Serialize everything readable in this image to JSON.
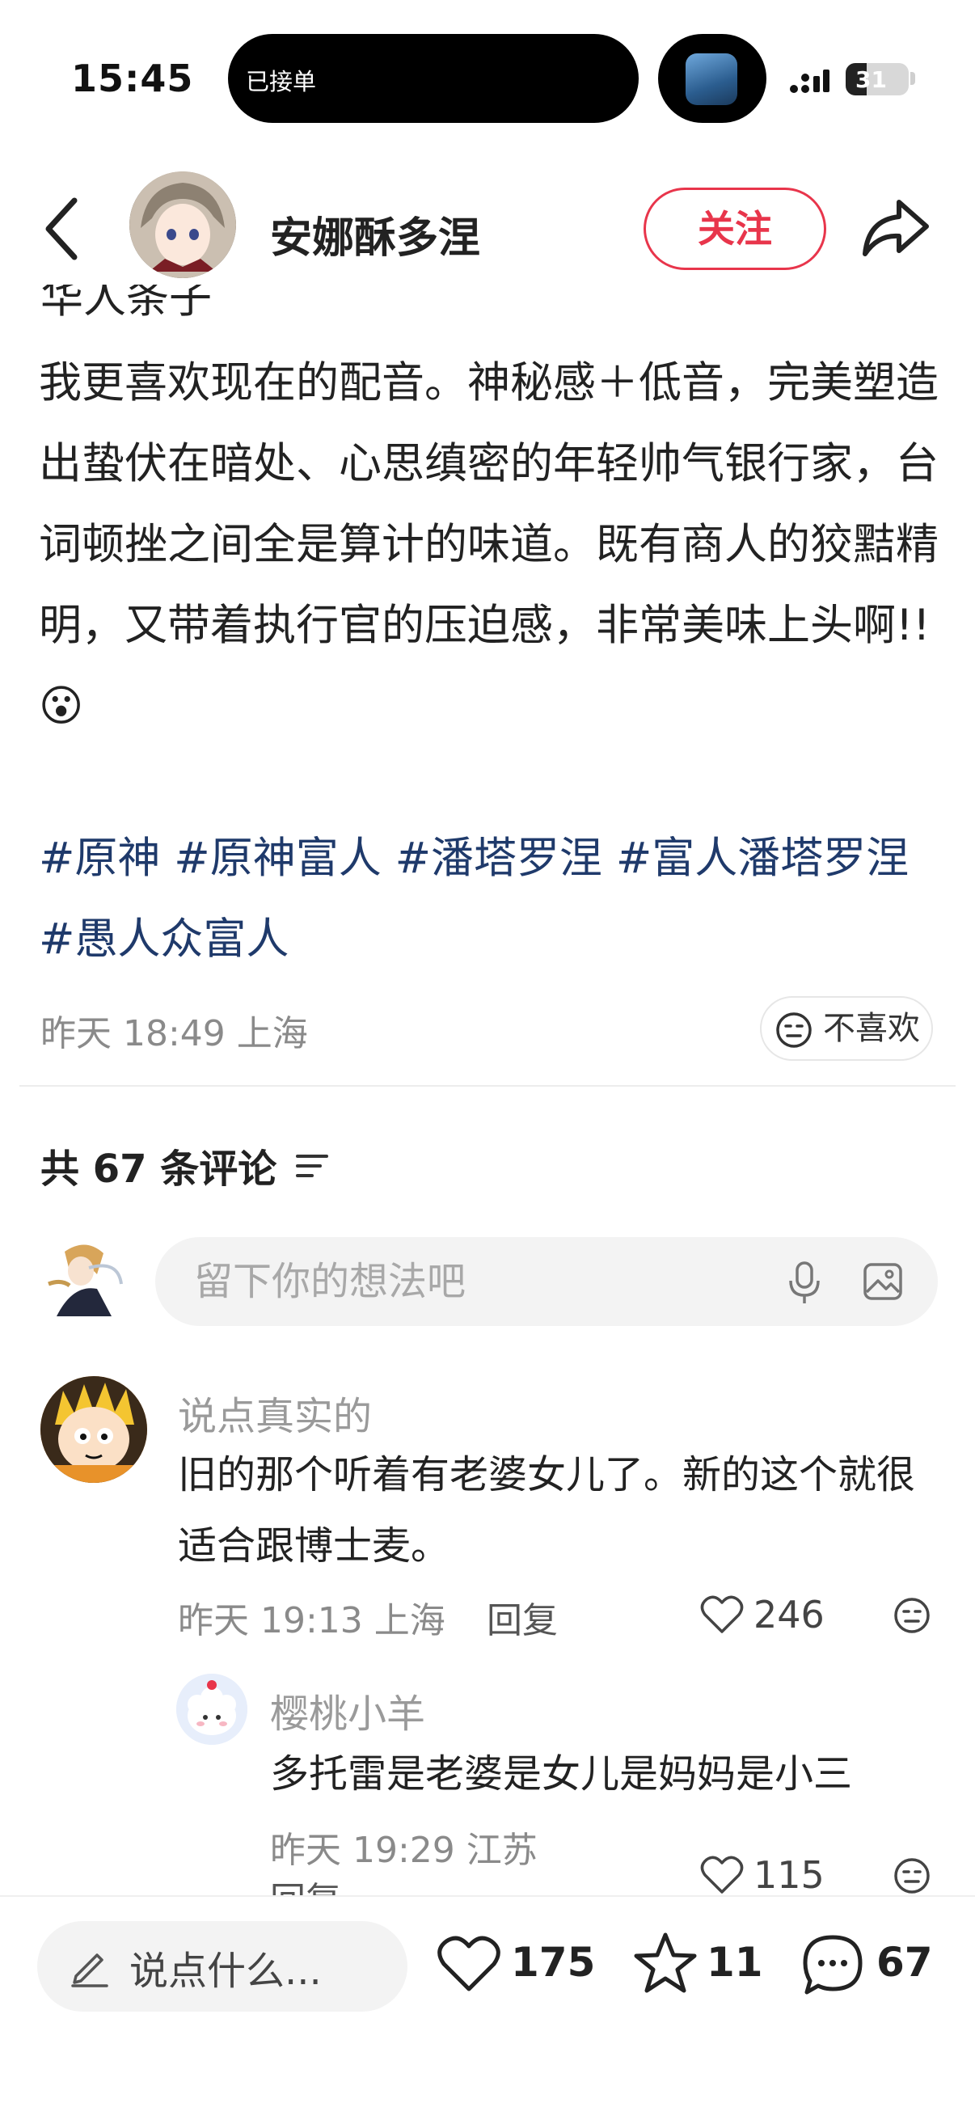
{
  "status_bar": {
    "time": "15:45",
    "island_label": "已接单",
    "battery": "31"
  },
  "header": {
    "author_name": "安娜酥多涅",
    "follow_label": "关注"
  },
  "post": {
    "cut_line_text": "华人条子",
    "body": "我更喜欢现在的配音。神秘感＋低音，完美塑造出蛰伏在暗处、心思缜密的年轻帅气银行家，台词顿挫之间全是算计的味道。既有商人的狡黠精明，又带着执行官的压迫感，非常美味上头啊!!😮",
    "hashtags": [
      "#原神",
      "#原神富人",
      "#潘塔罗涅",
      "#富人潘塔罗涅",
      "#愚人众富人"
    ],
    "meta": "昨天 18:49 上海",
    "dislike_label": "不喜欢"
  },
  "comments_section": {
    "count_label": "共 67 条评论",
    "input_placeholder": "留下你的想法吧",
    "comments": [
      {
        "author": "说点真实的",
        "text": "旧的那个听着有老婆女儿了。新的这个就很适合跟博士麦。",
        "meta": "昨天 19:13 上海",
        "reply_label": "回复",
        "likes": "246"
      }
    ],
    "replies": [
      {
        "author": "樱桃小羊",
        "text": "多托雷是老婆是女儿是妈妈是小三",
        "meta": "昨天 19:29 江苏",
        "reply_label": "回复",
        "likes": "115"
      }
    ]
  },
  "bottom_bar": {
    "say_placeholder": "说点什么...",
    "likes": "175",
    "stars": "11",
    "comments": "67"
  },
  "colors": {
    "accent": "#e8354b",
    "hashtag": "#1f3a6b",
    "muted": "#8a8a8a"
  },
  "icons": [
    "back-icon",
    "share-icon",
    "dislike-face-icon",
    "sort-icon",
    "mic-icon",
    "image-icon",
    "heart-icon",
    "star-icon",
    "comment-icon",
    "pen-icon"
  ]
}
